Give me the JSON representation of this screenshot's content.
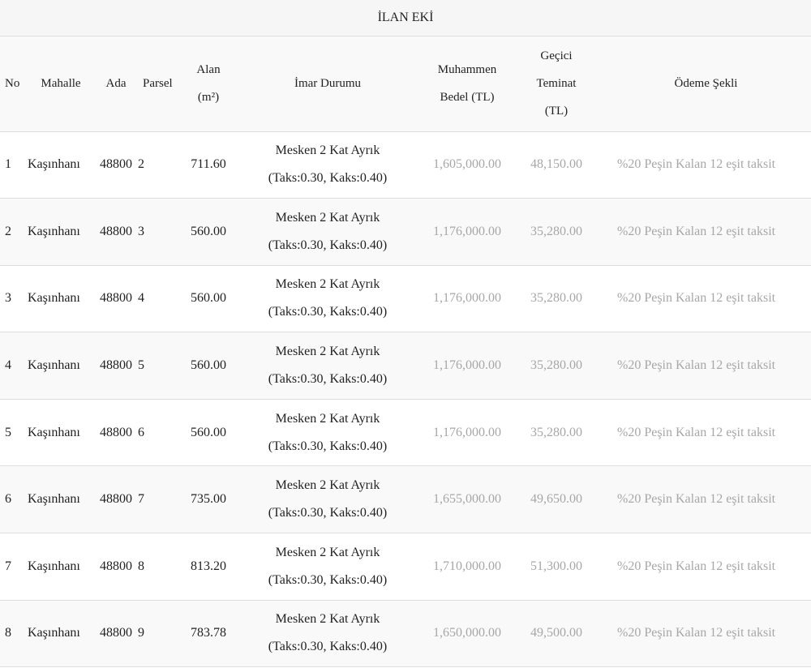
{
  "title": "İLAN EKİ",
  "headers": {
    "no": "No",
    "mahalle": "Mahalle",
    "ada": "Ada",
    "parsel": "Parsel",
    "alan_line1": "Alan",
    "alan_line2": "(m²)",
    "imar": "İmar Durumu",
    "muhammen_line1": "Muhammen",
    "muhammen_line2": "Bedel (TL)",
    "teminat_line1": "Geçici",
    "teminat_line2": "Teminat",
    "teminat_line3": "(TL)",
    "odeme": "Ödeme Şekli"
  },
  "rows": [
    {
      "no": "1",
      "mahalle": "Kaşınhanı",
      "ada": "48800",
      "parsel": "2",
      "alan": "711.60",
      "imar1": "Mesken 2 Kat Ayrık",
      "imar2": "(Taks:0.30, Kaks:0.40)",
      "bedel": "1,605,000.00",
      "teminat": "48,150.00",
      "odeme": "%20 Peşin Kalan 12 eşit taksit"
    },
    {
      "no": "2",
      "mahalle": "Kaşınhanı",
      "ada": "48800",
      "parsel": "3",
      "alan": "560.00",
      "imar1": "Mesken 2 Kat Ayrık",
      "imar2": "(Taks:0.30, Kaks:0.40)",
      "bedel": "1,176,000.00",
      "teminat": "35,280.00",
      "odeme": "%20 Peşin Kalan 12 eşit taksit"
    },
    {
      "no": "3",
      "mahalle": "Kaşınhanı",
      "ada": "48800",
      "parsel": "4",
      "alan": "560.00",
      "imar1": "Mesken 2 Kat Ayrık",
      "imar2": "(Taks:0.30, Kaks:0.40)",
      "bedel": "1,176,000.00",
      "teminat": "35,280.00",
      "odeme": "%20 Peşin Kalan 12 eşit taksit"
    },
    {
      "no": "4",
      "mahalle": "Kaşınhanı",
      "ada": "48800",
      "parsel": "5",
      "alan": "560.00",
      "imar1": "Mesken 2 Kat Ayrık",
      "imar2": "(Taks:0.30, Kaks:0.40)",
      "bedel": "1,176,000.00",
      "teminat": "35,280.00",
      "odeme": "%20 Peşin Kalan 12 eşit taksit"
    },
    {
      "no": "5",
      "mahalle": "Kaşınhanı",
      "ada": "48800",
      "parsel": "6",
      "alan": "560.00",
      "imar1": "Mesken 2 Kat Ayrık",
      "imar2": "(Taks:0.30, Kaks:0.40)",
      "bedel": "1,176,000.00",
      "teminat": "35,280.00",
      "odeme": "%20 Peşin Kalan 12 eşit taksit"
    },
    {
      "no": "6",
      "mahalle": "Kaşınhanı",
      "ada": "48800",
      "parsel": "7",
      "alan": "735.00",
      "imar1": "Mesken 2 Kat Ayrık",
      "imar2": "(Taks:0.30, Kaks:0.40)",
      "bedel": "1,655,000.00",
      "teminat": "49,650.00",
      "odeme": "%20 Peşin Kalan 12 eşit taksit"
    },
    {
      "no": "7",
      "mahalle": "Kaşınhanı",
      "ada": "48800",
      "parsel": "8",
      "alan": "813.20",
      "imar1": "Mesken 2 Kat Ayrık",
      "imar2": "(Taks:0.30, Kaks:0.40)",
      "bedel": "1,710,000.00",
      "teminat": "51,300.00",
      "odeme": "%20 Peşin Kalan 12 eşit taksit"
    },
    {
      "no": "8",
      "mahalle": "Kaşınhanı",
      "ada": "48800",
      "parsel": "9",
      "alan": "783.78",
      "imar1": "Mesken 2 Kat Ayrık",
      "imar2": "(Taks:0.30, Kaks:0.40)",
      "bedel": "1,650,000.00",
      "teminat": "49,500.00",
      "odeme": "%20 Peşin Kalan 12 eşit taksit"
    }
  ]
}
